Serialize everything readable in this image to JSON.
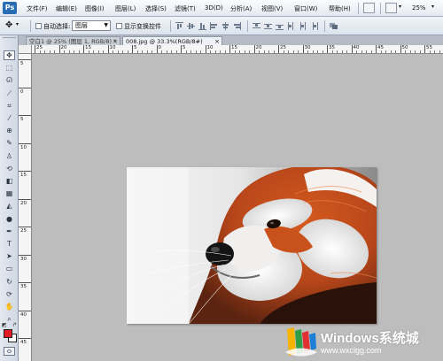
{
  "app": {
    "logo": "Ps"
  },
  "menu": {
    "items": [
      "文件(F)",
      "编辑(E)",
      "图像(I)",
      "图层(L)",
      "选择(S)",
      "滤镜(T)",
      "3D(D)",
      "分析(A)",
      "视图(V)",
      "窗口(W)",
      "帮助(H)"
    ],
    "zoom": "25%"
  },
  "options": {
    "auto_select_label": "自动选择:",
    "layer_select_value": "图层",
    "show_transform_label": "显示变换控件"
  },
  "tabs": [
    {
      "label": "空白1 @ 25% (图层 1, RGB/8) *",
      "active": false
    },
    {
      "label": "008.jpg @ 33.3%(RGB/8#)",
      "active": true
    }
  ],
  "ruler": {
    "h_labels": [
      "25",
      "20",
      "15",
      "10",
      "5",
      "0",
      "5",
      "10",
      "15",
      "20",
      "25",
      "30",
      "35",
      "40",
      "45",
      "50",
      "55"
    ],
    "v_labels": [
      "5",
      "0",
      "5",
      "10",
      "15",
      "20",
      "25",
      "30",
      "35",
      "40",
      "45"
    ]
  },
  "tools": [
    {
      "icon": "move-icon",
      "glyph": "✥"
    },
    {
      "icon": "marquee-icon",
      "glyph": "⬚"
    },
    {
      "icon": "lasso-icon",
      "glyph": "ᘏ"
    },
    {
      "icon": "magic-wand-icon",
      "glyph": "⟋"
    },
    {
      "icon": "crop-icon",
      "glyph": "⌗"
    },
    {
      "icon": "eyedropper-icon",
      "glyph": "⁄"
    },
    {
      "icon": "healing-brush-icon",
      "glyph": "⊕"
    },
    {
      "icon": "brush-icon",
      "glyph": "✎"
    },
    {
      "icon": "clone-stamp-icon",
      "glyph": "♙"
    },
    {
      "icon": "history-brush-icon",
      "glyph": "⟲"
    },
    {
      "icon": "eraser-icon",
      "glyph": "◧"
    },
    {
      "icon": "gradient-icon",
      "glyph": "▦"
    },
    {
      "icon": "blur-icon",
      "glyph": "◭"
    },
    {
      "icon": "dodge-icon",
      "glyph": "●"
    },
    {
      "icon": "pen-icon",
      "glyph": "✒"
    },
    {
      "icon": "type-icon",
      "glyph": "T"
    },
    {
      "icon": "path-selection-icon",
      "glyph": "➤"
    },
    {
      "icon": "shape-icon",
      "glyph": "▭"
    },
    {
      "icon": "3d-rotate-icon",
      "glyph": "↻"
    },
    {
      "icon": "3d-orbit-icon",
      "glyph": "⟳"
    },
    {
      "icon": "hand-icon",
      "glyph": "✋"
    },
    {
      "icon": "zoom-icon",
      "glyph": "⌕"
    }
  ],
  "colors": {
    "foreground": "#e31c23",
    "background": "#ffffff",
    "accent": "#2a6cb4"
  },
  "watermark": {
    "title": "Windows系统城",
    "url": "www.wxclgg.com"
  }
}
